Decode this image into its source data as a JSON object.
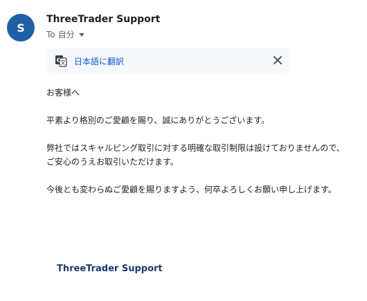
{
  "sender": {
    "avatar_initial": "S",
    "avatar_color": "#1f5fa6",
    "name": "ThreeTrader Support"
  },
  "recipient": {
    "to_label": "To",
    "name": "自分",
    "dropdown_icon": "caret-down-icon"
  },
  "translate_bar": {
    "icon": "translate-icon",
    "link_label": "日本語に翻訳",
    "close_icon": "close-icon",
    "link_color": "#0b57d0"
  },
  "message": {
    "greeting": "お客様へ",
    "paragraph_1": "平素より格別のご愛顧を賜り、誠にありがとうございます。",
    "paragraph_2_line_1": "弊社ではスキャルピング取引に対する明確な取引制限は設けておりませんので、",
    "paragraph_2_line_2": "ご安心のうえお取引いただけます。",
    "paragraph_3": "今後とも変わらぬご愛顧を賜りますよう、何卒よろしくお願い申し上げます。"
  },
  "signature": {
    "name": "ThreeTrader Support",
    "color": "#1c3a70"
  }
}
